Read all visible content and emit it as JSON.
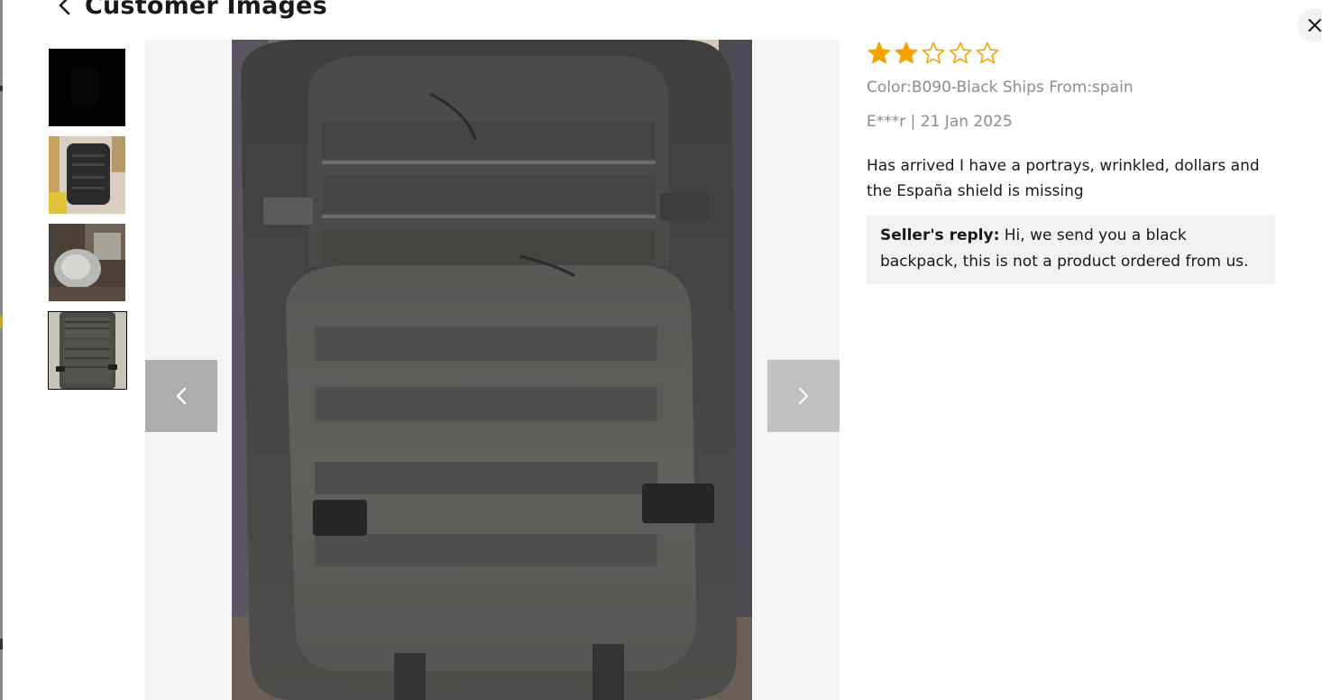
{
  "header": {
    "title": "Customer Images",
    "back_icon": "chevron-left-icon"
  },
  "close_icon": "close-icon",
  "thumbnails": [
    {
      "name": "thumb-1",
      "selected": false
    },
    {
      "name": "thumb-2",
      "selected": false
    },
    {
      "name": "thumb-3",
      "selected": false
    },
    {
      "name": "thumb-4",
      "selected": true
    }
  ],
  "viewer": {
    "prev_icon": "chevron-left-icon",
    "next_icon": "chevron-right-icon"
  },
  "review": {
    "rating": 2,
    "rating_max": 5,
    "star_color": "#f5a300",
    "attributes": "Color:B090-Black Ships From:spain",
    "author_date": "E***r | 21 Jan 2025",
    "text": "Has arrived I have a portrays, wrinkled, dollars and the España shield is missing",
    "seller_reply_label": "Seller's reply:",
    "seller_reply_text": " Hi, we send you a black backpack, this is not a product ordered from us."
  }
}
